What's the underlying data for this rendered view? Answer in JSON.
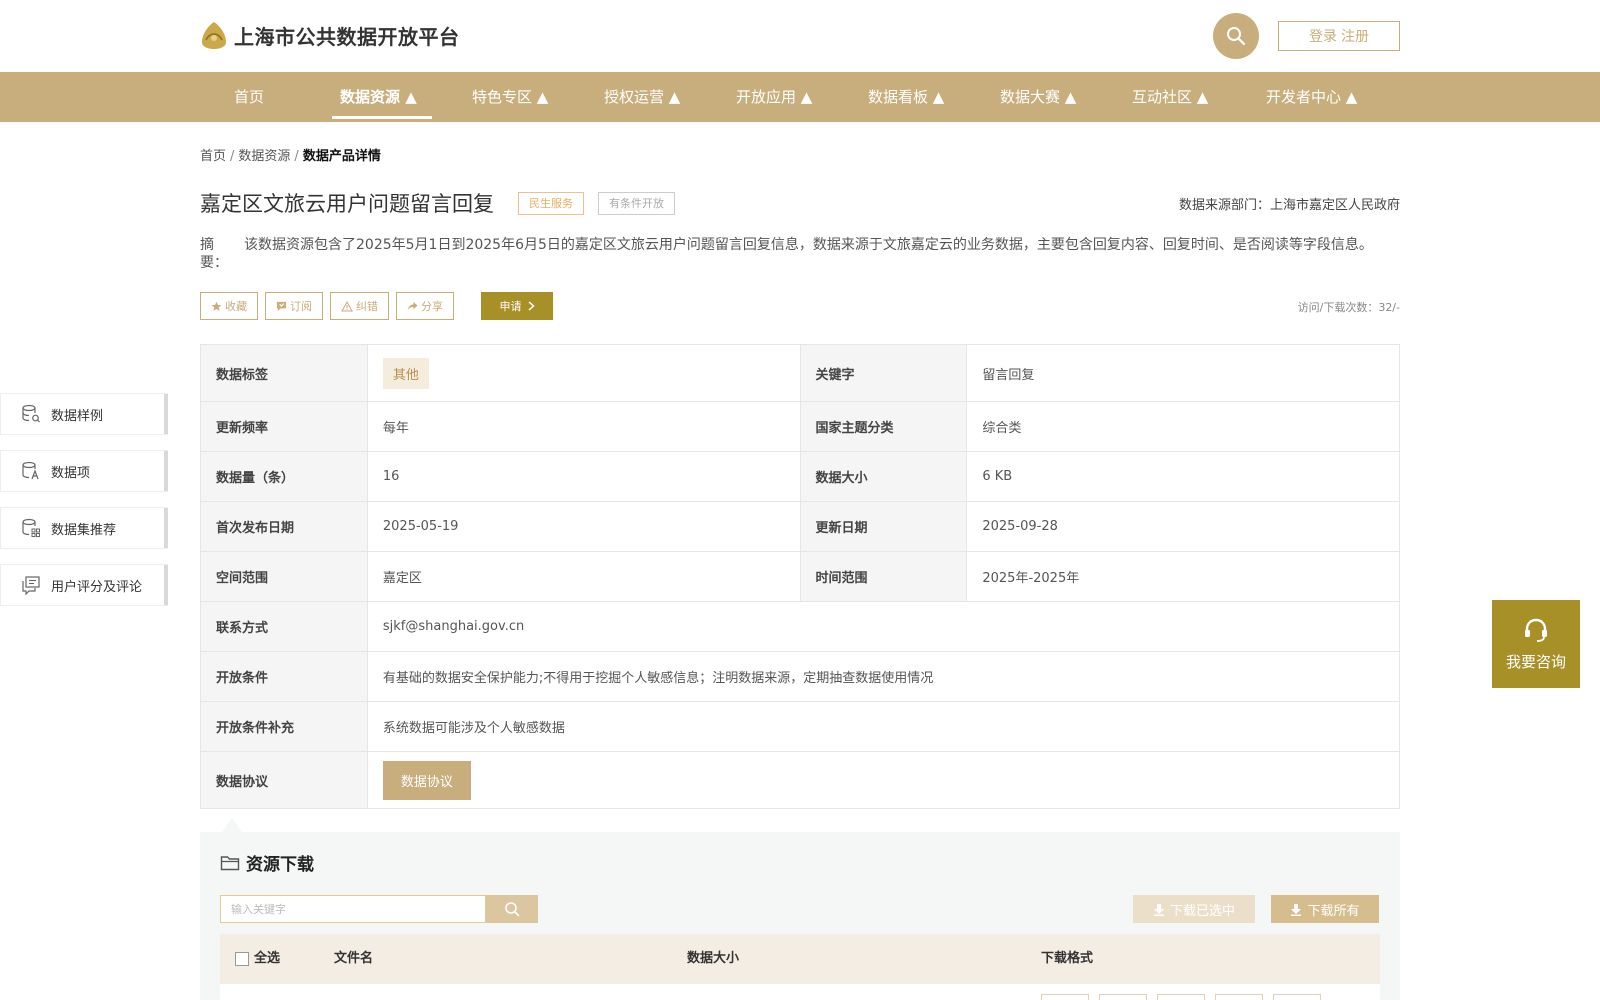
{
  "header": {
    "site_title": "上海市公共数据开放平台",
    "login": "登录",
    "register": "注册"
  },
  "nav": {
    "items": [
      {
        "label": "首页"
      },
      {
        "label": "数据资源 ▲"
      },
      {
        "label": "特色专区 ▲"
      },
      {
        "label": "授权运营 ▲"
      },
      {
        "label": "开放应用 ▲"
      },
      {
        "label": "数据看板 ▲"
      },
      {
        "label": "数据大赛 ▲"
      },
      {
        "label": "互动社区 ▲"
      },
      {
        "label": "开发者中心 ▲"
      }
    ],
    "active_index": 1
  },
  "breadcrumb": {
    "items": [
      "首页",
      "数据资源",
      "数据产品详情"
    ],
    "separator": "/"
  },
  "product": {
    "title": "嘉定区文旅云用户问题留言回复",
    "tag_service": "民生服务",
    "tag_open": "有条件开放",
    "source": "数据来源部门：上海市嘉定区人民政府",
    "summary_label": "摘　　要：",
    "summary": "该数据资源包含了2025年5月1日到2025年6月5日的嘉定区文旅云用户问题留言回复信息，数据来源于文旅嘉定云的业务数据，主要包含回复内容、回复时间、是否阅读等字段信息。"
  },
  "actions": {
    "favorite": "收藏",
    "subscribe": "订阅",
    "correct": "纠错",
    "share": "分享",
    "apply": "申请",
    "visits": "访问/下载次数：32/-"
  },
  "info": {
    "tags_label": "数据标签",
    "tags_value": "其他",
    "keyword_label": "关键字",
    "keyword_value": "留言回复",
    "freq_label": "更新频率",
    "freq_value": "每年",
    "theme_label": "国家主题分类",
    "theme_value": "综合类",
    "count_label": "数据量（条）",
    "count_value": "16",
    "size_label": "数据大小",
    "size_value": "6 KB",
    "first_label": "首次发布日期",
    "first_value": "2025-05-19",
    "update_label": "更新日期",
    "update_value": "2025-09-28",
    "space_label": "空间范围",
    "space_value": "嘉定区",
    "time_label": "时间范围",
    "time_value": "2025年-2025年",
    "contact_label": "联系方式",
    "contact_value": "sjkf@shanghai.gov.cn",
    "cond_label": "开放条件",
    "cond_value": "有基础的数据安全保护能力;不得用于挖掘个人敏感信息；注明数据来源，定期抽查数据使用情况",
    "cond_extra_label": "开放条件补充",
    "cond_extra_value": "系统数据可能涉及个人敏感数据",
    "agreement_label": "数据协议",
    "agreement_button": "数据协议"
  },
  "side": {
    "items": [
      {
        "label": "数据样例",
        "icon": "database-search-icon"
      },
      {
        "label": "数据项",
        "icon": "database-text-icon"
      },
      {
        "label": "数据集推荐",
        "icon": "database-grid-icon"
      },
      {
        "label": "用户评分及评论",
        "icon": "comment-icon"
      }
    ]
  },
  "consult": {
    "label": "我要咨询",
    "icon": "headset-icon"
  },
  "resources": {
    "title": "资源下载",
    "search_placeholder": "输入关键字",
    "download_selected": "下载已选中",
    "download_all": "下载所有",
    "columns": {
      "select_all": "全选",
      "filename": "文件名",
      "size": "数据大小",
      "format": "下载格式"
    }
  },
  "colors": {
    "brand": "#c8ae7d",
    "apply": "#a89028",
    "consult": "#a89028"
  }
}
